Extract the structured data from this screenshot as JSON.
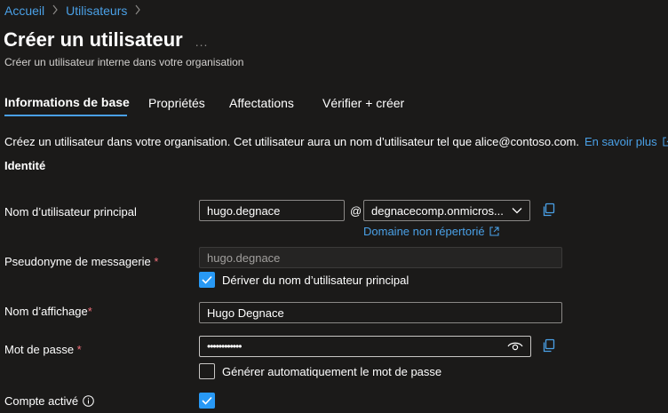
{
  "breadcrumb": {
    "items": [
      "Accueil",
      "Utilisateurs"
    ]
  },
  "header": {
    "title": "Créer un utilisateur",
    "more": "...",
    "subtitle": "Créer un utilisateur interne dans votre organisation"
  },
  "tabs": [
    {
      "label": "Informations de base",
      "active": true
    },
    {
      "label": "Propriétés"
    },
    {
      "label": "Affectations"
    },
    {
      "label": "Vérifier + créer"
    }
  ],
  "description": {
    "text": "Créez un utilisateur dans votre organisation. Cet utilisateur aura un nom d’utilisateur tel que alice@contoso.com.",
    "link": "En savoir plus"
  },
  "section": {
    "title": "Identité"
  },
  "form": {
    "upn": {
      "label": "Nom d’utilisateur principal",
      "value": "hugo.degnace",
      "at": "@",
      "domain": "degnacecomp.onmicros...",
      "domain_link": "Domaine non répertorié"
    },
    "mail_nickname": {
      "label": "Pseudonyme de messagerie",
      "required": "*",
      "value": "hugo.degnace",
      "derive_label": "Dériver du nom d’utilisateur principal",
      "derive_checked": true
    },
    "display_name": {
      "label": "Nom d’affichage",
      "required": "*",
      "value": "Hugo Degnace"
    },
    "password": {
      "label": "Mot de passe",
      "required": "*",
      "value": "••••••••••••",
      "autogen_label": "Générer automatiquement le mot de passe",
      "autogen_checked": false
    },
    "account_enabled": {
      "label": "Compte activé",
      "checked": true
    }
  },
  "colors": {
    "background": "#1b1a19",
    "accent": "#4aa0e6",
    "checkbox": "#2899f5",
    "required": "#f1707b"
  }
}
